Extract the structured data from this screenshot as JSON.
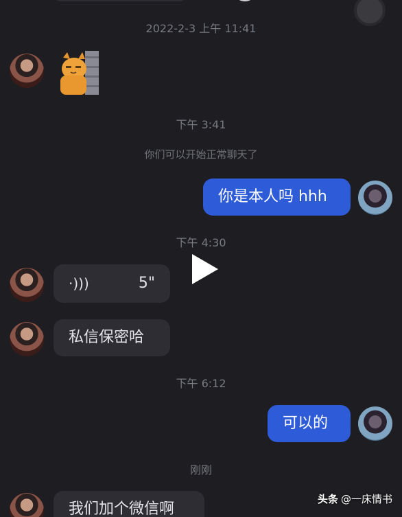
{
  "messages": {
    "ts1": "2022-2-3 上午 11:41",
    "ts2": "下午 3:41",
    "sys_note": "你们可以开始正常聊天了",
    "out1": "你是本人吗 hhh",
    "ts3": "下午 4:30",
    "voice_duration": "5\"",
    "in_text1": "私信保密哈",
    "ts4": "下午 6:12",
    "out2": "可以的",
    "ts5": "刚刚",
    "in_text2": "我们加个微信啊"
  },
  "watermark": {
    "brand": "头条",
    "handle": "@一床情书"
  },
  "colors": {
    "background": "#1e1e22",
    "incoming_bubble": "#2d2d33",
    "outgoing_bubble": "#2e5bd8",
    "timestamp": "#777a80"
  }
}
